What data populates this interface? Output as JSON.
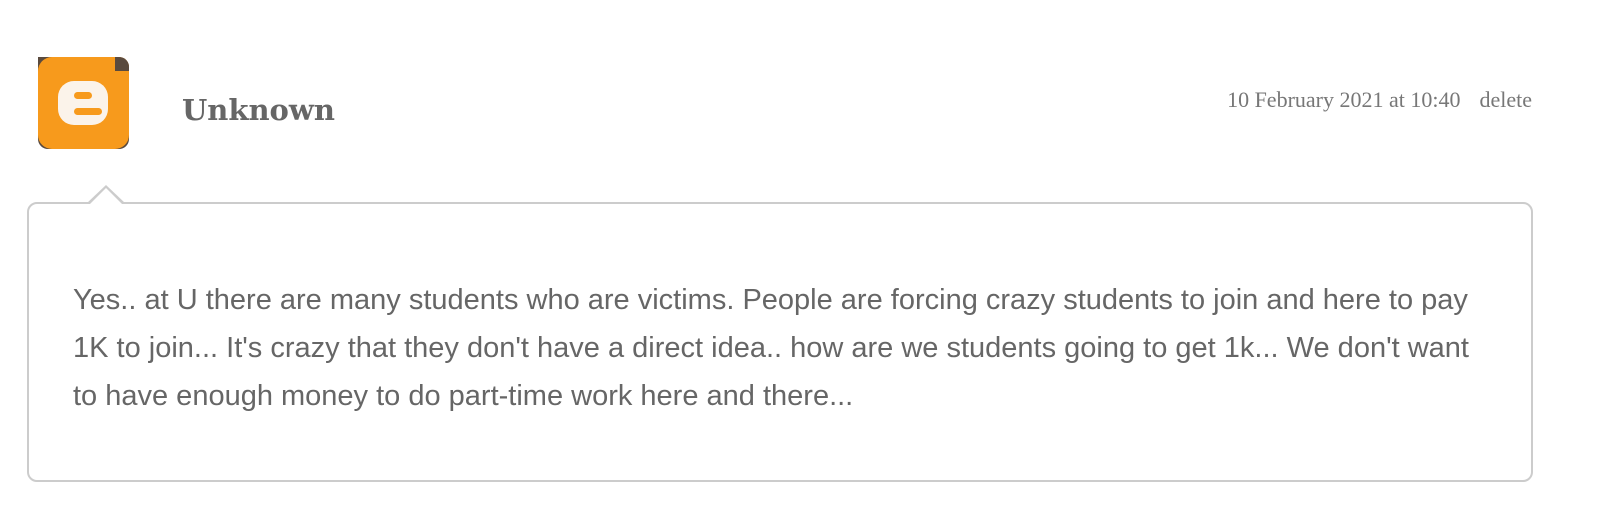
{
  "comment": {
    "author": "Unknown",
    "timestamp": "10 February 2021 at 10:40",
    "delete_label": "delete",
    "avatar_icon": "blogger-logo-icon",
    "body": "Yes.. at U there are many students who are victims. People are forcing crazy students to join and here to pay 1K to join... It's crazy that they don't have a direct idea.. how are we students going to get 1k... We don't want to have enough money to do part-time work here and there..."
  },
  "colors": {
    "avatar_orange": "#f79a1c",
    "text": "#666666",
    "border": "#cccccc"
  }
}
